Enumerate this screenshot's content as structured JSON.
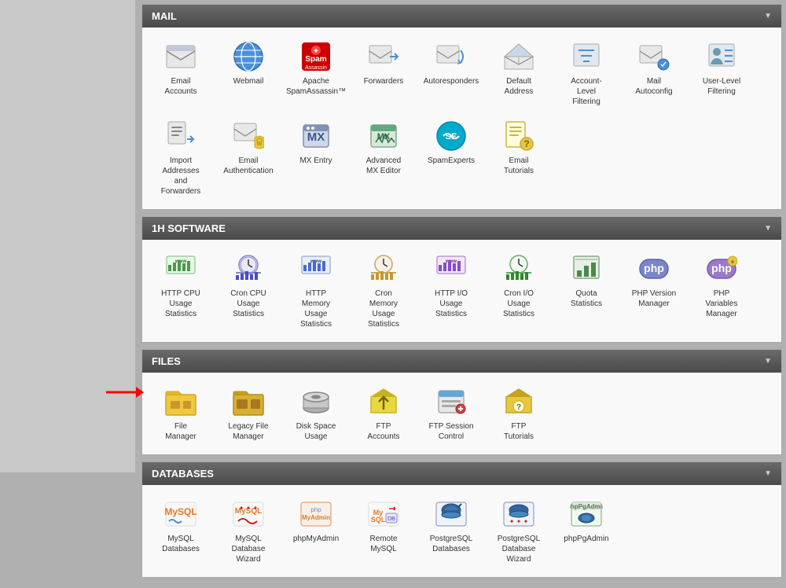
{
  "sections": [
    {
      "id": "mail",
      "header": "MAIL",
      "items": [
        {
          "id": "email-accounts",
          "label": "Email\nAccounts",
          "icon": "email"
        },
        {
          "id": "webmail",
          "label": "Webmail",
          "icon": "webmail"
        },
        {
          "id": "spamassassin",
          "label": "Apache\nSpamAssassin™",
          "icon": "spam"
        },
        {
          "id": "forwarders",
          "label": "Forwarders",
          "icon": "forwarders"
        },
        {
          "id": "autoresponders",
          "label": "Autoresponders",
          "icon": "autoresponders"
        },
        {
          "id": "default-address",
          "label": "Default\nAddress",
          "icon": "default-address"
        },
        {
          "id": "account-filtering",
          "label": "Account-\nLevel\nFiltering",
          "icon": "filtering"
        },
        {
          "id": "mail-autoconfig",
          "label": "Mail\nAutoconfig",
          "icon": "mail-autoconfig"
        },
        {
          "id": "user-filtering",
          "label": "User-Level\nFiltering",
          "icon": "user-filtering"
        },
        {
          "id": "import-addresses",
          "label": "Import\nAddresses\nand\nForwarders",
          "icon": "import"
        },
        {
          "id": "email-auth",
          "label": "Email\nAuthentication",
          "icon": "email-auth"
        },
        {
          "id": "mx-entry",
          "label": "MX Entry",
          "icon": "mx-entry"
        },
        {
          "id": "advanced-mx",
          "label": "Advanced\nMX Editor",
          "icon": "advanced-mx"
        },
        {
          "id": "spamexperts",
          "label": "SpamExperts",
          "icon": "spamexperts"
        },
        {
          "id": "email-tutorials",
          "label": "Email\nTutorials",
          "icon": "email-tutorials"
        }
      ]
    },
    {
      "id": "1h-software",
      "header": "1H SOFTWARE",
      "items": [
        {
          "id": "http-cpu",
          "label": "HTTP CPU\nUsage\nStatistics",
          "icon": "stats-green"
        },
        {
          "id": "cron-cpu",
          "label": "Cron CPU\nUsage\nStatistics",
          "icon": "stats-clock"
        },
        {
          "id": "http-memory",
          "label": "HTTP\nMemory\nUsage\nStatistics",
          "icon": "stats-blue"
        },
        {
          "id": "cron-memory",
          "label": "Cron\nMemory\nUsage\nStatistics",
          "icon": "stats-clock2"
        },
        {
          "id": "http-io",
          "label": "HTTP I/O\nUsage\nStatistics",
          "icon": "stats-io"
        },
        {
          "id": "cron-io",
          "label": "Cron I/O\nUsage\nStatistics",
          "icon": "stats-io2"
        },
        {
          "id": "quota-stats",
          "label": "Quota\nStatistics",
          "icon": "quota"
        },
        {
          "id": "php-version",
          "label": "PHP Version\nManager",
          "icon": "php"
        },
        {
          "id": "php-variables",
          "label": "PHP\nVariables\nManager",
          "icon": "php2"
        }
      ]
    },
    {
      "id": "files",
      "header": "FILES",
      "items": [
        {
          "id": "file-manager",
          "label": "File\nManager",
          "icon": "file-manager",
          "highlighted": true
        },
        {
          "id": "legacy-file-manager",
          "label": "Legacy File\nManager",
          "icon": "legacy-file-manager"
        },
        {
          "id": "disk-space",
          "label": "Disk Space\nUsage",
          "icon": "disk-space"
        },
        {
          "id": "ftp-accounts",
          "label": "FTP\nAccounts",
          "icon": "ftp-accounts"
        },
        {
          "id": "ftp-session",
          "label": "FTP Session\nControl",
          "icon": "ftp-session"
        },
        {
          "id": "ftp-tutorials",
          "label": "FTP\nTutorials",
          "icon": "ftp-tutorials"
        }
      ]
    },
    {
      "id": "databases",
      "header": "DATABASES",
      "items": [
        {
          "id": "mysql-db",
          "label": "MySQL\nDatabases",
          "icon": "mysql"
        },
        {
          "id": "mysql-wizard",
          "label": "MySQL\nDatabase\nWizard",
          "icon": "mysql-wizard"
        },
        {
          "id": "phpmyadmin",
          "label": "phpMyAdmin",
          "icon": "phpmyadmin"
        },
        {
          "id": "remote-mysql",
          "label": "Remote\nMySQL",
          "icon": "remote-mysql"
        },
        {
          "id": "postgresql",
          "label": "PostgreSQL\nDatabases",
          "icon": "postgresql"
        },
        {
          "id": "postgresql-wizard",
          "label": "PostgreSQL\nDatabase\nWizard",
          "icon": "postgresql-wizard"
        },
        {
          "id": "phppgadmin",
          "label": "phpPgAdmin",
          "icon": "phppgadmin"
        }
      ]
    }
  ]
}
